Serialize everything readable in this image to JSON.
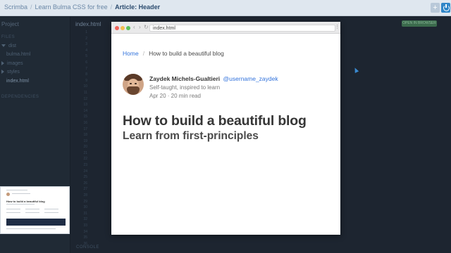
{
  "header": {
    "breadcrumbs": [
      "Scrimba",
      "Learn Bulma CSS for free",
      "Article: Header"
    ],
    "plus_label": "+"
  },
  "editor": {
    "sidebar_title": "Project",
    "sections": {
      "files": "FILES",
      "dependencies": "DEPENDENCIES"
    },
    "tree": [
      {
        "label": "dist",
        "type": "folder-open"
      },
      {
        "label": "bulma.html",
        "type": "file"
      },
      {
        "label": "images",
        "type": "folder"
      },
      {
        "label": "styles",
        "type": "folder"
      },
      {
        "label": "index.html",
        "type": "file-active"
      }
    ],
    "open_file": "index.html",
    "run_label": "OPEN IN BROWSER",
    "console_label": "CONSOLE",
    "line_numbers": [
      "1",
      "2",
      "3",
      "4",
      "5",
      "6",
      "7",
      "8",
      "9",
      "10",
      "11",
      "12",
      "13",
      "14",
      "15",
      "16",
      "17",
      "18",
      "19",
      "20",
      "21",
      "22",
      "23",
      "24",
      "25",
      "26",
      "27",
      "28",
      "29",
      "30",
      "31",
      "32",
      "33",
      "34",
      "35",
      "36"
    ]
  },
  "browser": {
    "url": "index.html",
    "nav": {
      "back": "‹",
      "forward": "›",
      "reload": "↻"
    },
    "menu": "⋮"
  },
  "article": {
    "breadcrumb": {
      "home": "Home",
      "separator": "/",
      "current": "How to build a beautiful blog"
    },
    "author": {
      "name": "Zaydek Michels-Gualtieri",
      "handle": "@username_zaydek",
      "bio": "Self-taught, inspired to learn",
      "meta": "Apr 20 · 20 min read"
    },
    "title": "How to build a beautiful blog",
    "subtitle": "Learn from first-principles"
  },
  "thumbnail": {
    "title": "How to build a beautiful blog"
  },
  "colors": {
    "link": "#3273dc",
    "title": "#363636",
    "editor_bg": "#1d2530",
    "topbar_bg": "#dfe7ef"
  }
}
